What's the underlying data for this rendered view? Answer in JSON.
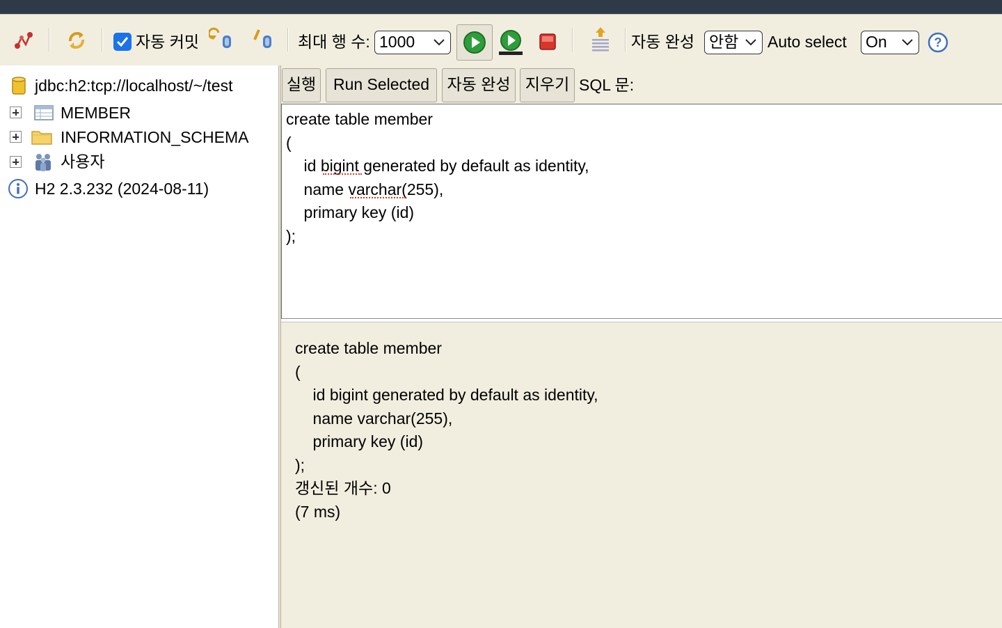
{
  "toolbar": {
    "auto_commit_label": "자동 커밋",
    "auto_commit_checked": true,
    "max_rows_label": "최대 행 수:",
    "max_rows_value": "1000",
    "autocomplete_label": "자동 완성",
    "autocomplete_value": "안함",
    "auto_select_label": "Auto select",
    "auto_select_value": "On"
  },
  "tree": {
    "connection": "jdbc:h2:tcp://localhost/~/test",
    "items": [
      {
        "label": "MEMBER",
        "icon": "table-icon"
      },
      {
        "label": "INFORMATION_SCHEMA",
        "icon": "folder-icon"
      },
      {
        "label": "사용자",
        "icon": "users-icon"
      }
    ],
    "version": "H2 2.3.232 (2024-08-11)"
  },
  "query": {
    "run_label": "실행",
    "run_selected_label": "Run Selected",
    "autocomplete_label": "자동 완성",
    "clear_label": "지우기",
    "sql_label": "SQL 문:"
  },
  "editor": {
    "lines": [
      "create table member",
      "(",
      "    id bigint generated by default as identity,",
      "    name varchar(255),",
      "    primary key (id)",
      ");"
    ]
  },
  "result": {
    "lines": [
      "create table member",
      "(",
      "    id bigint generated by default as identity,",
      "    name varchar(255),",
      "    primary key (id)",
      ");"
    ],
    "update_count": "갱신된 개수: 0",
    "time": "(7 ms)"
  },
  "colors": {
    "accent": "#1a73e8",
    "run_green": "#2e9e3a",
    "stop_red": "#d9352b",
    "panel_bg": "#f1eee0"
  }
}
